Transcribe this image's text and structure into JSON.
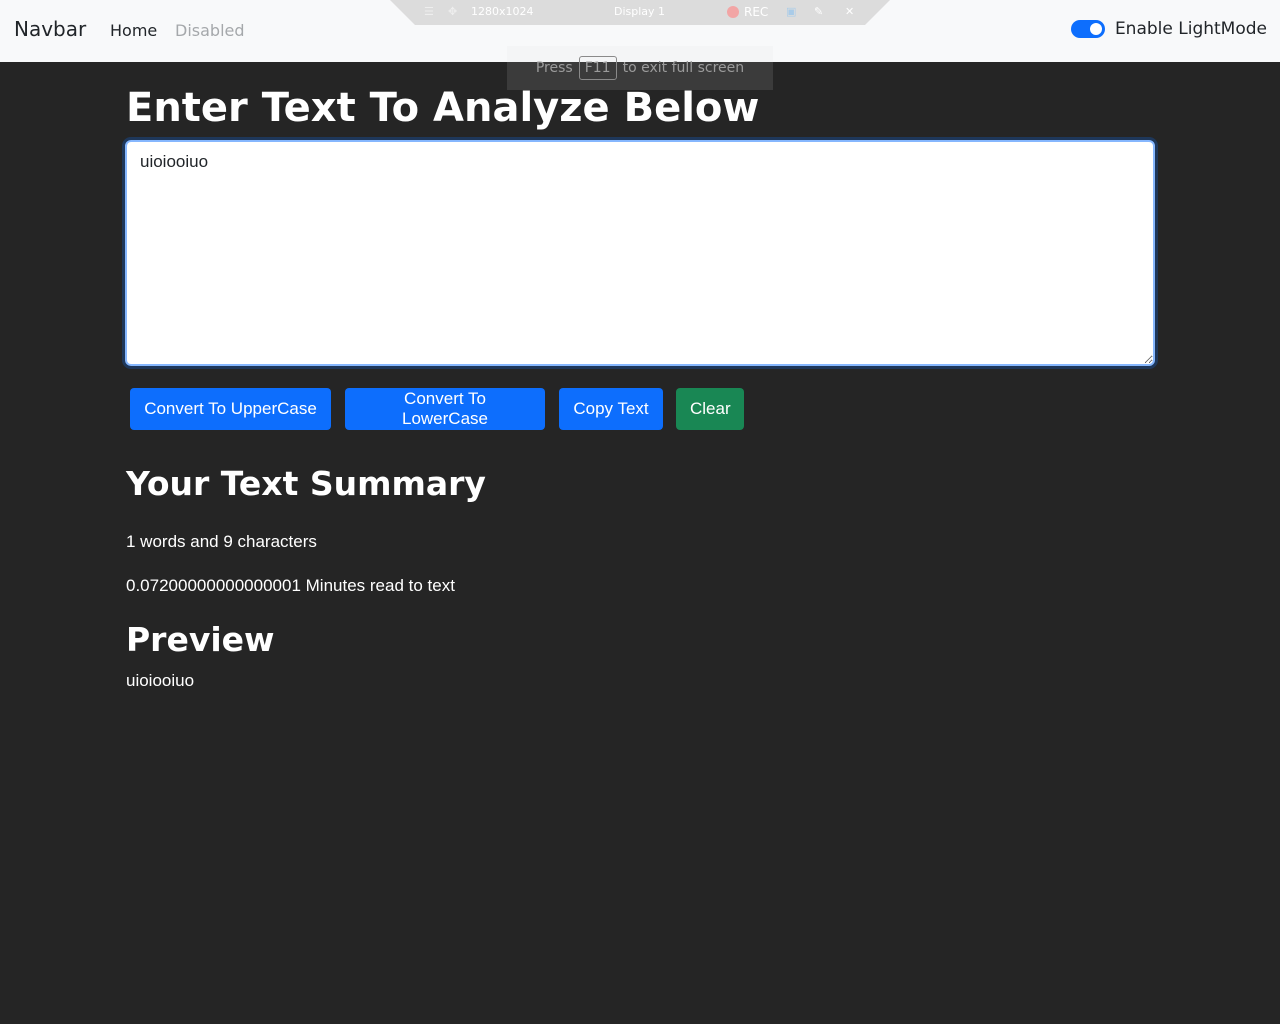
{
  "navbar": {
    "brand": "Navbar",
    "links": [
      {
        "label": "Home",
        "disabled": false
      },
      {
        "label": "Disabled",
        "disabled": true
      }
    ],
    "mode_toggle": {
      "label": "Enable LightMode",
      "checked": true
    }
  },
  "recorder": {
    "resolution": "1280x1024",
    "display": "Display 1",
    "rec_label": "REC",
    "fullscreen_hint": {
      "before": "Press",
      "key": "F11",
      "after": "to exit full screen"
    }
  },
  "main": {
    "heading": "Enter Text To Analyze Below",
    "textarea_value": "uioiooiuo",
    "buttons": {
      "upper": "Convert To UpperCase",
      "lower": "Convert To LowerCase",
      "copy": "Copy Text",
      "clear": "Clear"
    },
    "summary": {
      "heading": "Your Text Summary",
      "words_line": "1 words and 9 characters",
      "minutes_line": "0.07200000000000001 Minutes read to text"
    },
    "preview": {
      "heading": "Preview",
      "text": "uioiooiuo"
    }
  },
  "colors": {
    "background": "#252525",
    "navbar": "#f8f9fa",
    "primary": "#0d6efd",
    "success": "#198754"
  }
}
